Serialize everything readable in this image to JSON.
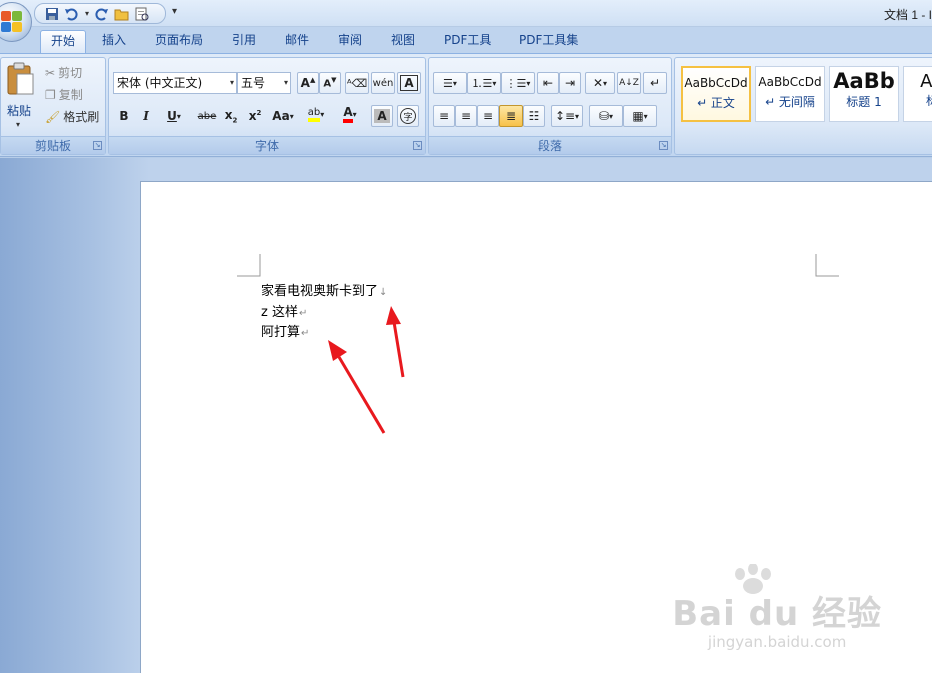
{
  "window": {
    "title": "文档 1 - I"
  },
  "qat": {
    "more": "▾"
  },
  "tabs": [
    "开始",
    "插入",
    "页面布局",
    "引用",
    "邮件",
    "审阅",
    "视图",
    "PDF工具",
    "PDF工具集"
  ],
  "clipboard": {
    "paste": "粘贴",
    "cut": "剪切",
    "copy": "复制",
    "format_painter": "格式刷",
    "label": "剪贴板"
  },
  "font": {
    "name": "宋体 (中文正文)",
    "size": "五号",
    "label": "字体"
  },
  "paragraph": {
    "label": "段落"
  },
  "styles": [
    {
      "sample": "AaBbCcDd",
      "name": "↵ 正文"
    },
    {
      "sample": "AaBbCcDd",
      "name": "↵ 无间隔"
    },
    {
      "sample": "AaBb",
      "name": "标题 1"
    },
    {
      "sample": "AaB",
      "name": "标题"
    }
  ],
  "document": {
    "lines": [
      "家看电视奥斯卡到了",
      "z 这样",
      "阿打算"
    ],
    "line_marks": [
      "↓",
      "↵",
      "↵"
    ]
  },
  "watermark": {
    "main": "Bai du 经验",
    "sub": "jingyan.baidu.com"
  },
  "colors": {
    "highlight": "#ffff00",
    "font_color": "#ff0000",
    "arrow": "#e8191e"
  }
}
